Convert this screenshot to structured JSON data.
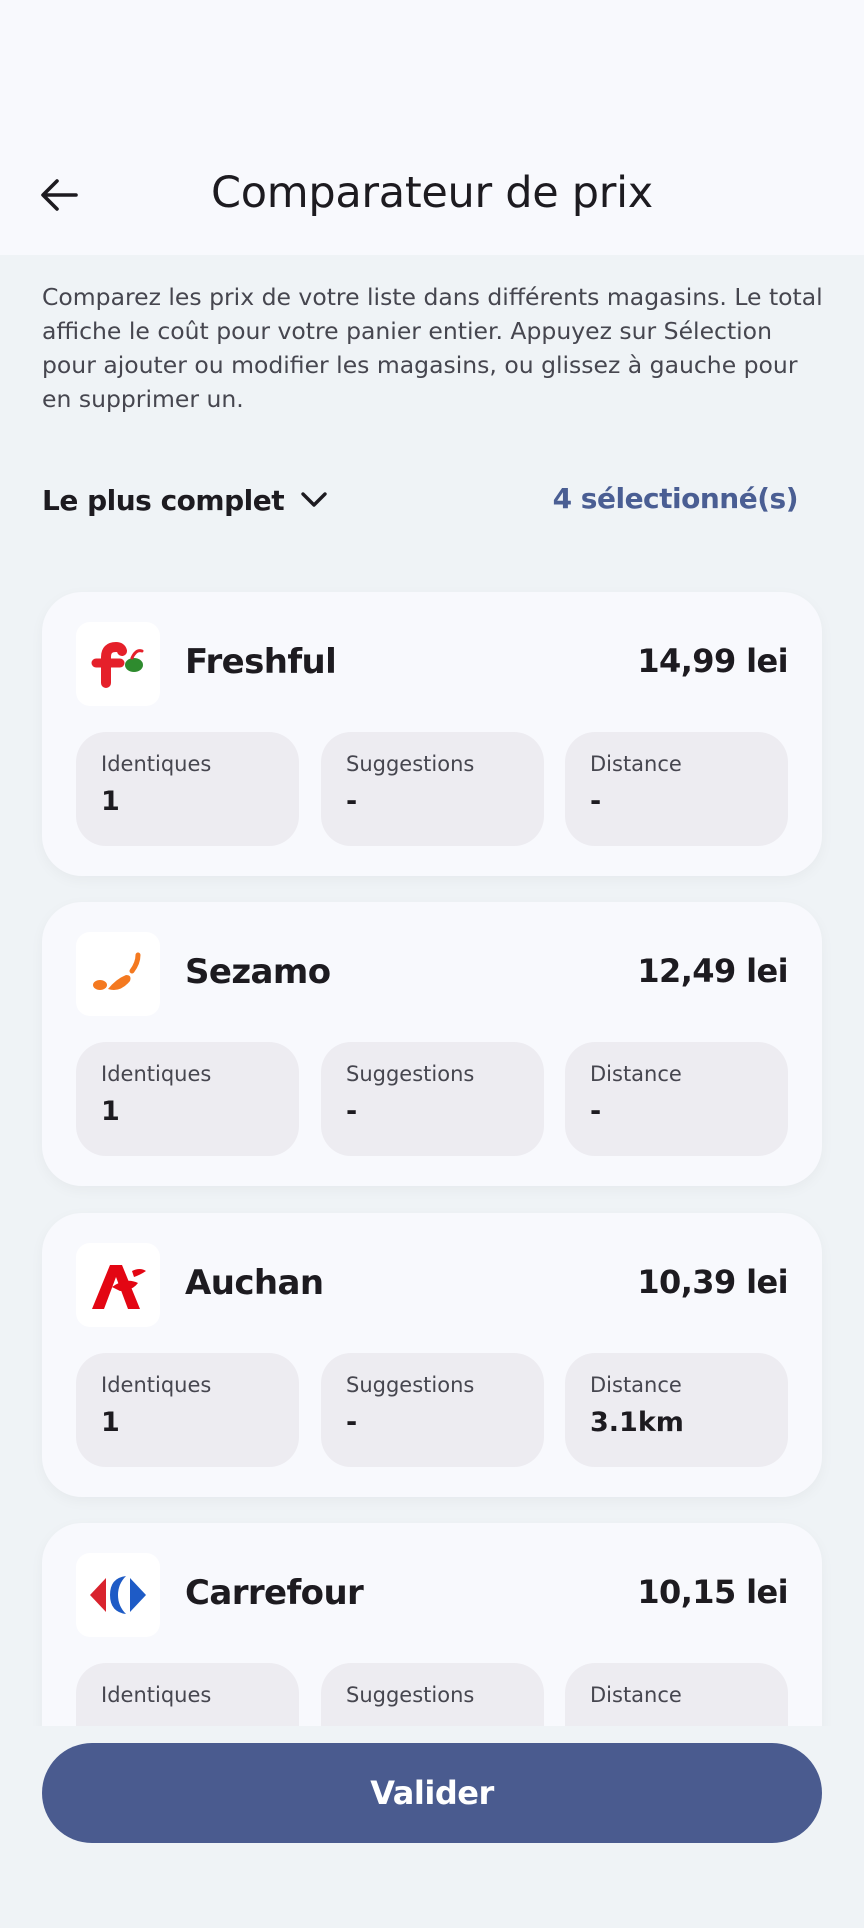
{
  "header": {
    "title": "Comparateur de prix",
    "back_icon": "arrow-left-icon"
  },
  "description": "Comparez les prix de votre liste dans différents magasins. Le total affiche le coût pour votre panier entier. Appuyez sur Sélection pour ajouter ou modifier les magasins, ou glissez à gauche pour en supprimer un.",
  "controls": {
    "sort_label": "Le plus complet",
    "sort_icon": "chevron-down-icon",
    "selected_label": "4 sélectionné(s)"
  },
  "stat_labels": {
    "identical": "Identiques",
    "suggestions": "Suggestions",
    "distance": "Distance"
  },
  "stores": [
    {
      "name": "Freshful",
      "price": "14,99 lei",
      "identical": "1",
      "suggestions": "-",
      "distance": "-",
      "logo": "freshful-logo"
    },
    {
      "name": "Sezamo",
      "price": "12,49 lei",
      "identical": "1",
      "suggestions": "-",
      "distance": "-",
      "logo": "sezamo-logo"
    },
    {
      "name": "Auchan",
      "price": "10,39 lei",
      "identical": "1",
      "suggestions": "-",
      "distance": "3.1km",
      "logo": "auchan-logo"
    },
    {
      "name": "Carrefour",
      "price": "10,15 lei",
      "logo": "carrefour-logo"
    }
  ],
  "colors": {
    "primary": "#4a5b8f",
    "link": "#4a5e93",
    "background": "#eff3f6",
    "card": "#f8f9fd",
    "stat_bg": "#edecf1"
  },
  "footer": {
    "validate_label": "Valider"
  }
}
